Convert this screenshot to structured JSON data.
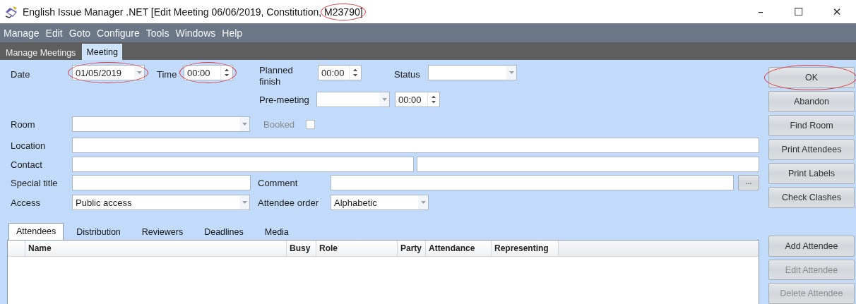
{
  "window": {
    "title_segments": [
      {
        "text": "English Issue Manager .NET [Edit Meeting 06/06/2019, Constitution,",
        "highlighted": false
      },
      {
        "text": "M23790]",
        "highlighted": true
      }
    ],
    "controls": [
      "–",
      "☐",
      "✕"
    ]
  },
  "menu": [
    "Manage",
    "Edit",
    "Goto",
    "Configure",
    "Tools",
    "Windows",
    "Help"
  ],
  "page_tabs": [
    {
      "label": "Manage Meetings",
      "selected": false
    },
    {
      "label": "Meeting",
      "selected": true
    }
  ],
  "form": {
    "date": {
      "label": "Date",
      "value": "01/05/2019",
      "highlighted": true
    },
    "time": {
      "label": "Time",
      "value": "00:00",
      "highlighted": true
    },
    "planned_finish": {
      "label": "Planned finish",
      "value": "00:00"
    },
    "status": {
      "label": "Status"
    },
    "pre_meeting": {
      "label": "Pre-meeting",
      "time": "00:00"
    },
    "room": {
      "label": "Room"
    },
    "booked": {
      "label": "Booked",
      "checked": false,
      "disabled": true
    },
    "location": {
      "label": "Location"
    },
    "contact": {
      "label": "Contact"
    },
    "special_title": {
      "label": "Special title"
    },
    "comment": {
      "label": "Comment",
      "button": "..."
    },
    "access": {
      "label": "Access",
      "value": "Public access"
    },
    "attendee_order": {
      "label": "Attendee order",
      "value": "Alphabetic"
    }
  },
  "actions": [
    {
      "label": "OK",
      "highlighted": true,
      "disabled": false
    },
    {
      "label": "Abandon",
      "highlighted": false,
      "disabled": false
    },
    {
      "label": "Find Room",
      "highlighted": false,
      "disabled": false
    },
    {
      "label": "Print Attendees",
      "highlighted": false,
      "disabled": false
    },
    {
      "label": "Print Labels",
      "highlighted": false,
      "disabled": false
    },
    {
      "label": "Check Clashes",
      "highlighted": false,
      "disabled": false
    }
  ],
  "attendee_actions": [
    {
      "label": "Add Attendee",
      "disabled": false
    },
    {
      "label": "Edit Attendee",
      "disabled": true
    },
    {
      "label": "Delete Attendee",
      "disabled": true
    }
  ],
  "detail_tabs": [
    {
      "label": "Attendees",
      "selected": true
    },
    {
      "label": "Distribution",
      "selected": false
    },
    {
      "label": "Reviewers",
      "selected": false
    },
    {
      "label": "Deadlines",
      "selected": false
    },
    {
      "label": "Media",
      "selected": false
    }
  ],
  "attendees_table": {
    "columns": [
      "Name",
      "Busy",
      "Role",
      "Party",
      "Attendance",
      "Representing"
    ]
  }
}
